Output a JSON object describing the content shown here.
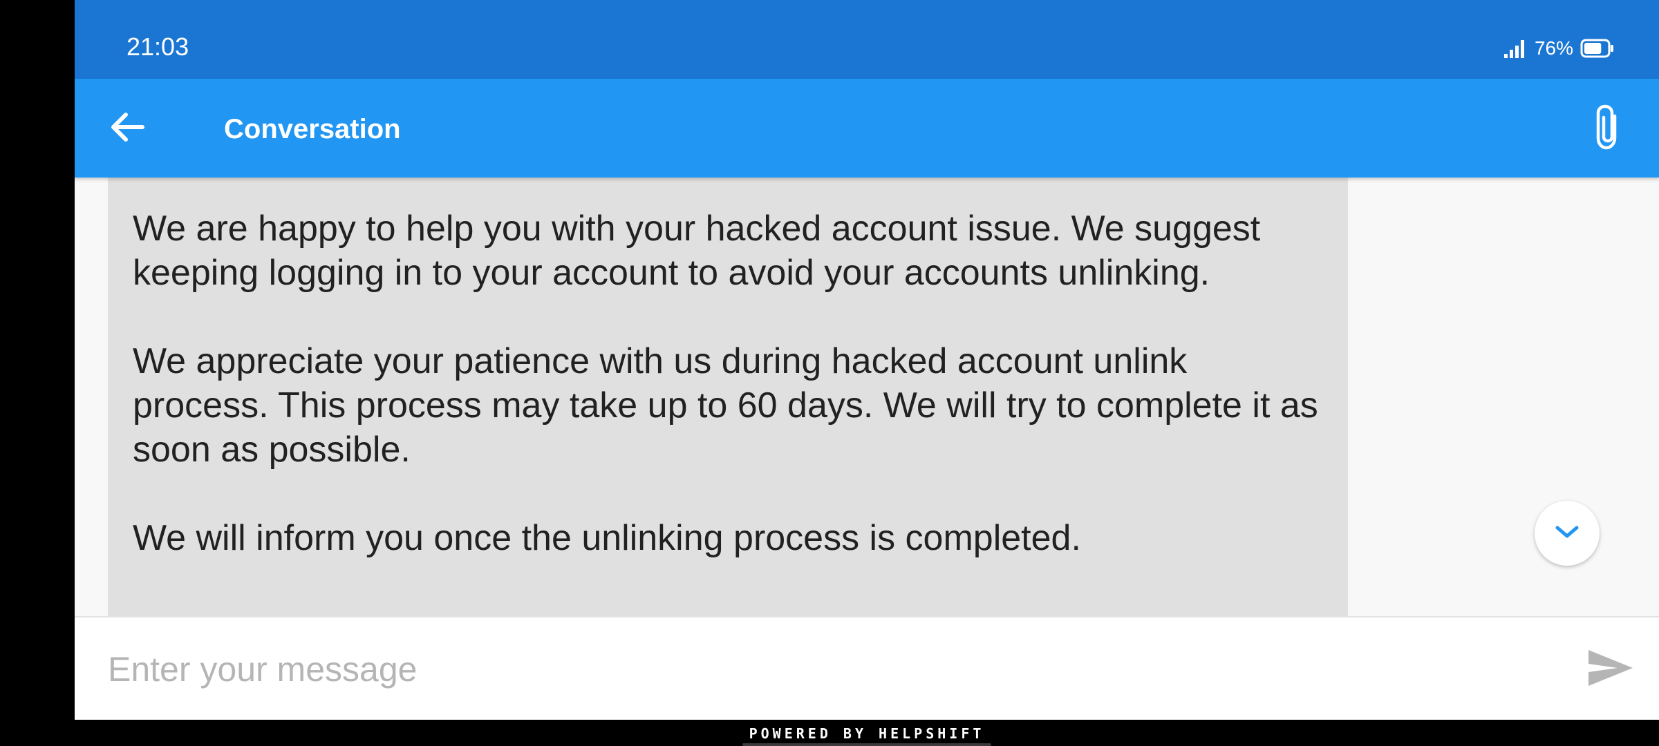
{
  "status_bar": {
    "time": "21:03",
    "battery_percent": "76%",
    "battery_level": 0.76,
    "signal_icon": "signal-bars-icon",
    "battery_icon": "battery-icon"
  },
  "toolbar": {
    "title": "Conversation",
    "back_icon": "arrow-back-icon",
    "attach_icon": "paperclip-icon"
  },
  "message": {
    "paragraphs": [
      "We are happy to help you with your hacked account issue. We suggest keeping logging in to your account to avoid your accounts unlinking.",
      "We appreciate your patience with us during hacked account unlink process. This process may take up to 60 days. We will try to complete it as soon as possible.",
      "We will inform you once the unlinking process is completed."
    ]
  },
  "scroll_button": {
    "icon": "chevron-down-icon"
  },
  "composer": {
    "placeholder": "Enter your message",
    "value": "",
    "send_icon": "send-icon"
  },
  "footer": {
    "powered_by": "POWERED BY HELPSHIFT"
  },
  "colors": {
    "status_bar": "#1a76d2",
    "toolbar": "#2196f3",
    "bubble": "#e0e0e0",
    "text": "#212121",
    "placeholder": "#b5b5b5",
    "accent": "#2196f3"
  }
}
